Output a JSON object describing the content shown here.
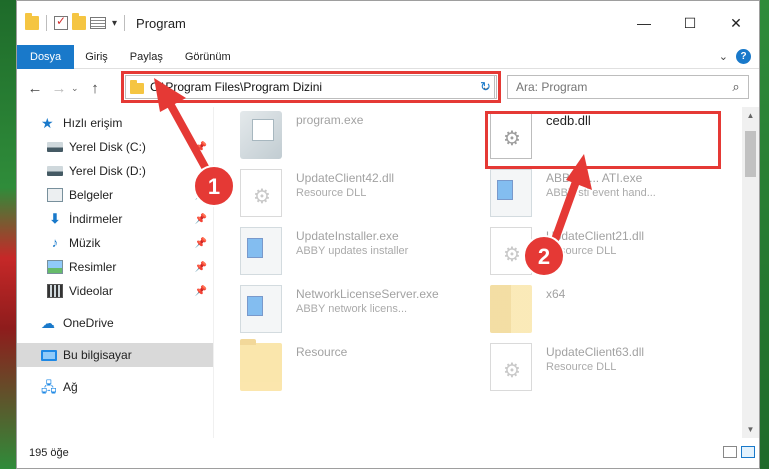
{
  "window": {
    "title": "Program",
    "minimize": "—",
    "maximize": "☐",
    "close": "✕"
  },
  "ribbon": {
    "tabs": [
      "Dosya",
      "Giriş",
      "Paylaş",
      "Görünüm"
    ],
    "expand_chevron": "⌄",
    "help": "?"
  },
  "navbar": {
    "back": "←",
    "forward": "→",
    "recent": "⌄",
    "up": "↑",
    "address": "C:\\Program Files\\Program Dizini",
    "address_dropdown": "⌄",
    "refresh": "↻",
    "search_placeholder": "Ara: Program",
    "search_icon": "⌕"
  },
  "sidebar": {
    "items": [
      {
        "label": "Hızlı erişim",
        "icon": "star-icon"
      },
      {
        "label": "Yerel Disk (C:)",
        "icon": "disk-icon",
        "pinned": true
      },
      {
        "label": "Yerel Disk (D:)",
        "icon": "disk-icon"
      },
      {
        "label": "Belgeler",
        "icon": "documents-icon",
        "pinned": true
      },
      {
        "label": "İndirmeler",
        "icon": "download-icon",
        "pinned": true
      },
      {
        "label": "Müzik",
        "icon": "music-icon",
        "pinned": true
      },
      {
        "label": "Resimler",
        "icon": "pictures-icon",
        "pinned": true
      },
      {
        "label": "Videolar",
        "icon": "videos-icon",
        "pinned": true
      },
      {
        "label": "OneDrive",
        "icon": "cloud-icon"
      },
      {
        "label": "Bu bilgisayar",
        "icon": "computer-icon",
        "selected": true
      },
      {
        "label": "Ağ",
        "icon": "network-icon"
      }
    ],
    "pin_glyph": "📌"
  },
  "files": [
    {
      "name": "program.exe",
      "desc": "",
      "icon": "exe-icon"
    },
    {
      "name": "cedb.dll",
      "desc": "",
      "icon": "dll-icon"
    },
    {
      "name": "UpdateClient42.dll",
      "desc": "Resource DLL",
      "icon": "dll-icon"
    },
    {
      "name": "ABBYY ... ATI.exe",
      "desc": "ABBY sti event hand...",
      "icon": "app-icon"
    },
    {
      "name": "UpdateInstaller.exe",
      "desc": "ABBY updates installer",
      "icon": "app-icon"
    },
    {
      "name": "UpdateClient21.dll",
      "desc": "Resource DLL",
      "icon": "dll-icon"
    },
    {
      "name": "NetworkLicenseServer.exe",
      "desc": "ABBY network licens...",
      "icon": "app-icon"
    },
    {
      "name": "x64",
      "desc": "",
      "icon": "folder-icon"
    },
    {
      "name": "Resource",
      "desc": "",
      "icon": "folder-icon"
    },
    {
      "name": "UpdateClient63.dll",
      "desc": "Resource DLL",
      "icon": "dll-icon"
    }
  ],
  "status": {
    "count": "195 öğe"
  },
  "annotations": {
    "step1": "1",
    "step2": "2",
    "color": "#e53935"
  },
  "scrollbar": {
    "up": "▲",
    "down": "▼"
  }
}
